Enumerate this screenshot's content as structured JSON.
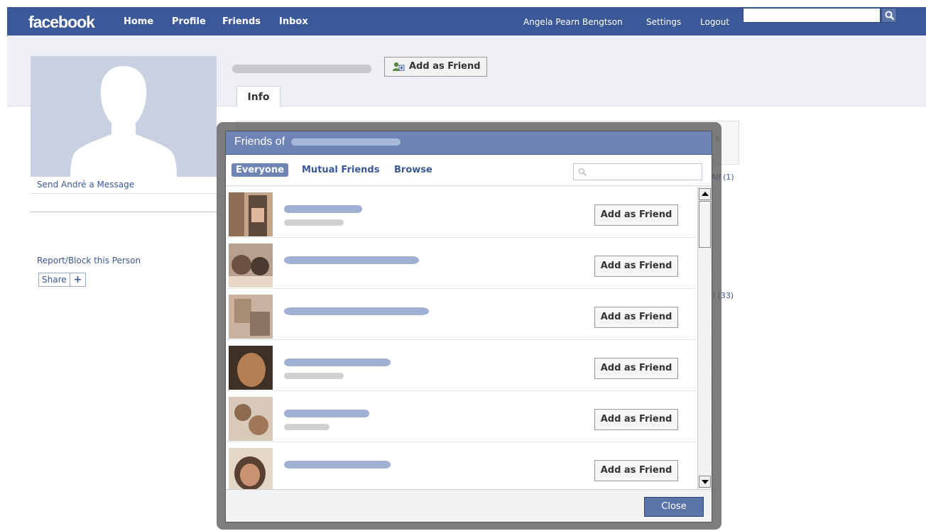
{
  "topbar": {
    "logo": "facebook",
    "nav": [
      "Home",
      "Profile",
      "Friends",
      "Inbox"
    ],
    "user_name": "Angela Pearn Bengtson",
    "settings": "Settings",
    "logout": "Logout",
    "search_placeholder": ""
  },
  "profile": {
    "send_message": "Send André a Message",
    "report_block": "Report/Block this Person",
    "share": "Share",
    "share_plus": "+",
    "add_as_friend": "Add as Friend",
    "tab_info": "Info",
    "side_all_1": "All (1)",
    "side_all_33": "ll (33)",
    "side_is": "s"
  },
  "dialog": {
    "title": "Friends of",
    "tabs": [
      "Everyone",
      "Mutual Friends",
      "Browse"
    ],
    "search_placeholder": "",
    "rows": [
      {
        "button": "Add as Friend"
      },
      {
        "button": "Add as Friend"
      },
      {
        "button": "Add as Friend"
      },
      {
        "button": "Add as Friend"
      },
      {
        "button": "Add as Friend"
      },
      {
        "button": "Add as Friend"
      }
    ],
    "close": "Close"
  },
  "colors": {
    "brand": "#3b5998",
    "header_light": "#6d84b4",
    "page_band": "#edeff4"
  }
}
